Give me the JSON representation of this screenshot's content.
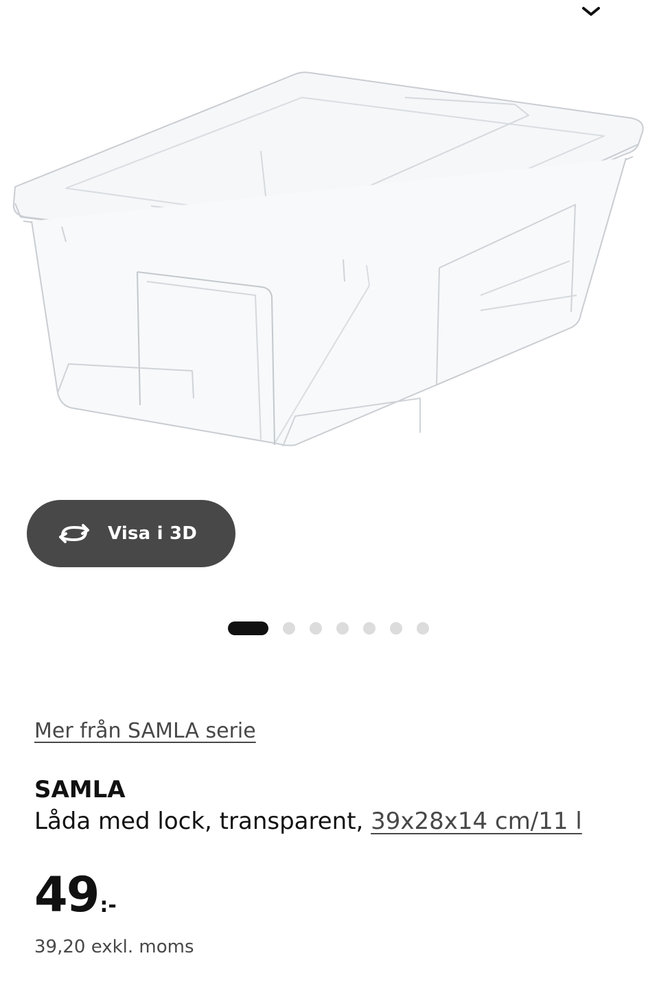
{
  "header": {
    "collapse_icon": "chevron-down-icon"
  },
  "gallery": {
    "image_alt": "SAMLA Låda med lock, transparent",
    "visa3d_label": "Visa i 3D",
    "visa3d_icon": "rotate-3d-icon",
    "dots_total": 7,
    "active_dot": 1
  },
  "product": {
    "series_link": "Mer från SAMLA serie",
    "name": "SAMLA",
    "description": "Låda med lock, transparent, ",
    "size_link": "39x28x14 cm/11 l",
    "price_integer": "49",
    "price_suffix": ":-",
    "price_excl_vat": "39,20 exkl. moms"
  },
  "colors": {
    "button_bg": "#484848",
    "active_dot": "#111111",
    "inactive_dot": "#dcdcdc",
    "text_primary": "#111111",
    "text_secondary": "#484848"
  }
}
